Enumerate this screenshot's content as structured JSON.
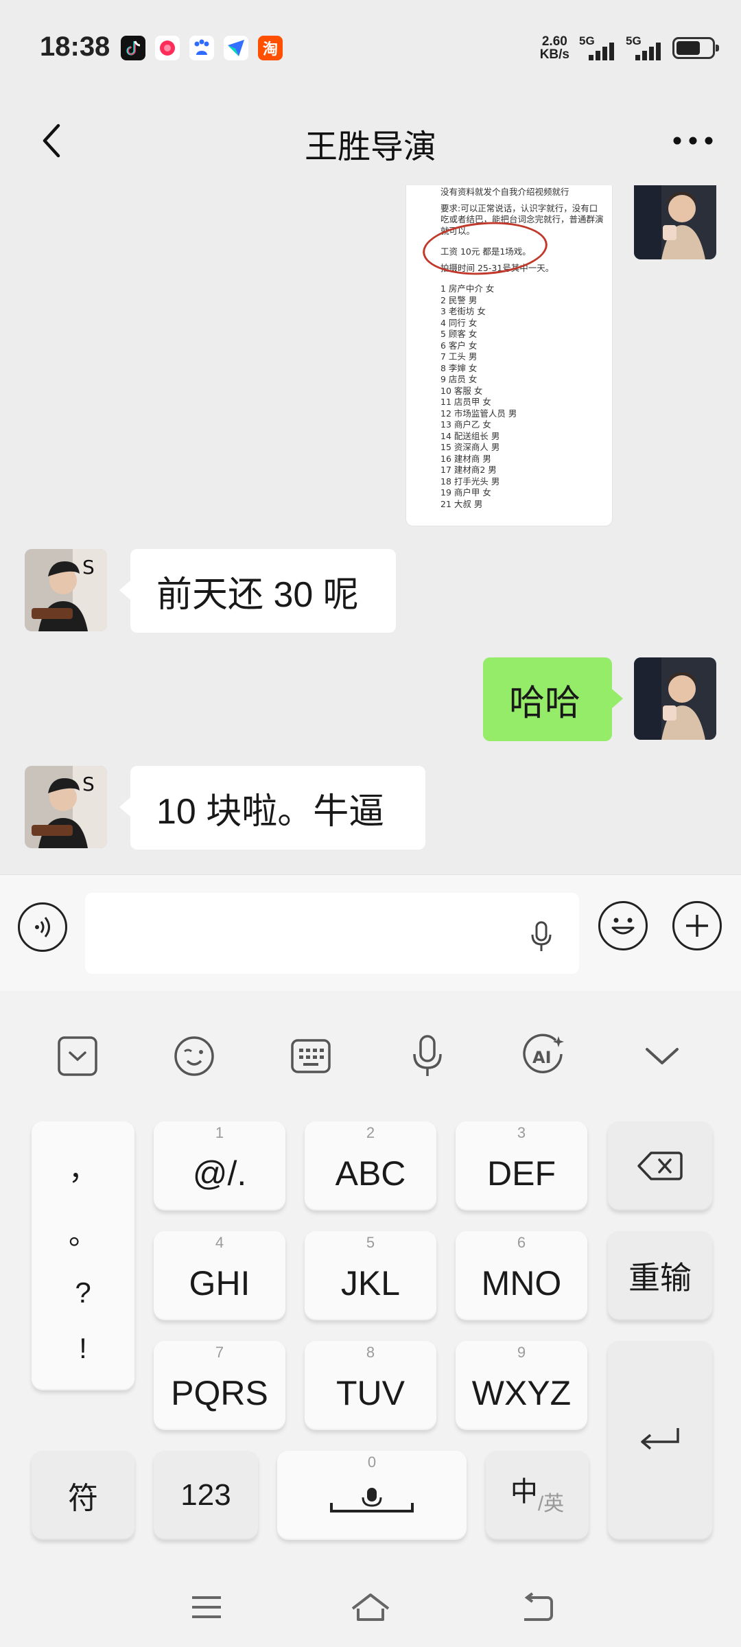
{
  "status_bar": {
    "time": "18:38",
    "speed_value": "2.60",
    "speed_unit": "KB/s",
    "signal1": "5G",
    "signal2": "5G",
    "app_icons": [
      "douyin-icon",
      "weibo-icon",
      "baidu-icon",
      "feishu-icon",
      "taobao-icon"
    ],
    "app_icon_label": "淘"
  },
  "nav": {
    "title": "王胜导演"
  },
  "image_message": {
    "lines": [
      "没有资料就发个自我介绍视频就行",
      "要求:可以正常说话，认识字就行，没有口吃或者结巴，能把台词念完就行，普通群演就可以。",
      "工资 10元 都是1场戏。",
      "拍摄时间 25-31号其中一天。"
    ],
    "roles": [
      "1 房产中介 女",
      "2 民警 男",
      "3 老街坊 女",
      "4 同行 女",
      "5 顾客 女",
      "6 客户 女",
      "7 工头 男",
      "8 李婶 女",
      "9 店员 女",
      "10 客服 女",
      "11 店员甲 女",
      "12 市场监管人员 男",
      "13 商户乙 女",
      "14 配送组长 男",
      "15 资深商人 男",
      "16 建材商 男",
      "17 建材商2 男",
      "18 打手光头 男",
      "19 商户甲 女",
      "21 大叔 男"
    ]
  },
  "messages": [
    {
      "direction": "in",
      "text": "前天还 30 呢"
    },
    {
      "direction": "out",
      "text": "哈哈"
    },
    {
      "direction": "in",
      "text": "10 块啦。牛逼"
    }
  ],
  "input": {
    "value": "",
    "placeholder": ""
  },
  "keyboard": {
    "punctuation": [
      "，",
      "。",
      "?",
      "!"
    ],
    "keys": [
      {
        "num": "1",
        "label": "@/."
      },
      {
        "num": "2",
        "label": "ABC"
      },
      {
        "num": "3",
        "label": "DEF"
      },
      {
        "num": "4",
        "label": "GHI"
      },
      {
        "num": "5",
        "label": "JKL"
      },
      {
        "num": "6",
        "label": "MNO"
      },
      {
        "num": "7",
        "label": "PQRS"
      },
      {
        "num": "8",
        "label": "TUV"
      },
      {
        "num": "9",
        "label": "WXYZ"
      }
    ],
    "retype": "重输",
    "symbols": "符",
    "numbers": "123",
    "space_num": "0",
    "lang_main": "中",
    "lang_sub": "/英"
  },
  "colors": {
    "outgoing_bubble": "#95ec69",
    "incoming_bubble": "#ffffff",
    "background": "#ededed"
  }
}
